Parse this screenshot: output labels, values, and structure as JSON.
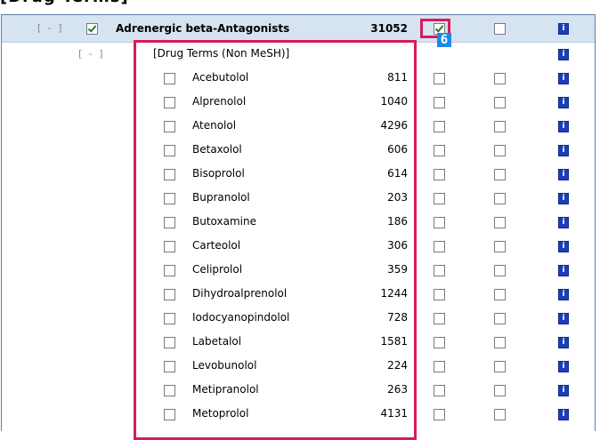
{
  "heading": "[Drug Terms]",
  "colors": {
    "header_bg": "#d6e3f1",
    "highlight": "#d81b5a",
    "info": "#1c3fb8",
    "badge": "#1e88e5"
  },
  "parent_row": {
    "toggle": "[ - ]",
    "checked": true,
    "label": "Adrenergic beta-Antagonists",
    "count": "31052",
    "col_a_checked": true,
    "col_b_checked": false,
    "info_icon": "info-icon"
  },
  "badge_label": "6",
  "group_row": {
    "toggle": "[ - ]",
    "label": "[Drug Terms (Non MeSH)]"
  },
  "drugs": [
    {
      "name": "Acebutolol",
      "count": "811"
    },
    {
      "name": "Alprenolol",
      "count": "1040"
    },
    {
      "name": "Atenolol",
      "count": "4296"
    },
    {
      "name": "Betaxolol",
      "count": "606"
    },
    {
      "name": "Bisoprolol",
      "count": "614"
    },
    {
      "name": "Bupranolol",
      "count": "203"
    },
    {
      "name": "Butoxamine",
      "count": "186"
    },
    {
      "name": "Carteolol",
      "count": "306"
    },
    {
      "name": "Celiprolol",
      "count": "359"
    },
    {
      "name": "Dihydroalprenolol",
      "count": "1244"
    },
    {
      "name": "Iodocyanopindolol",
      "count": "728"
    },
    {
      "name": "Labetalol",
      "count": "1581"
    },
    {
      "name": "Levobunolol",
      "count": "224"
    },
    {
      "name": "Metipranolol",
      "count": "263"
    },
    {
      "name": "Metoprolol",
      "count": "4131"
    }
  ]
}
